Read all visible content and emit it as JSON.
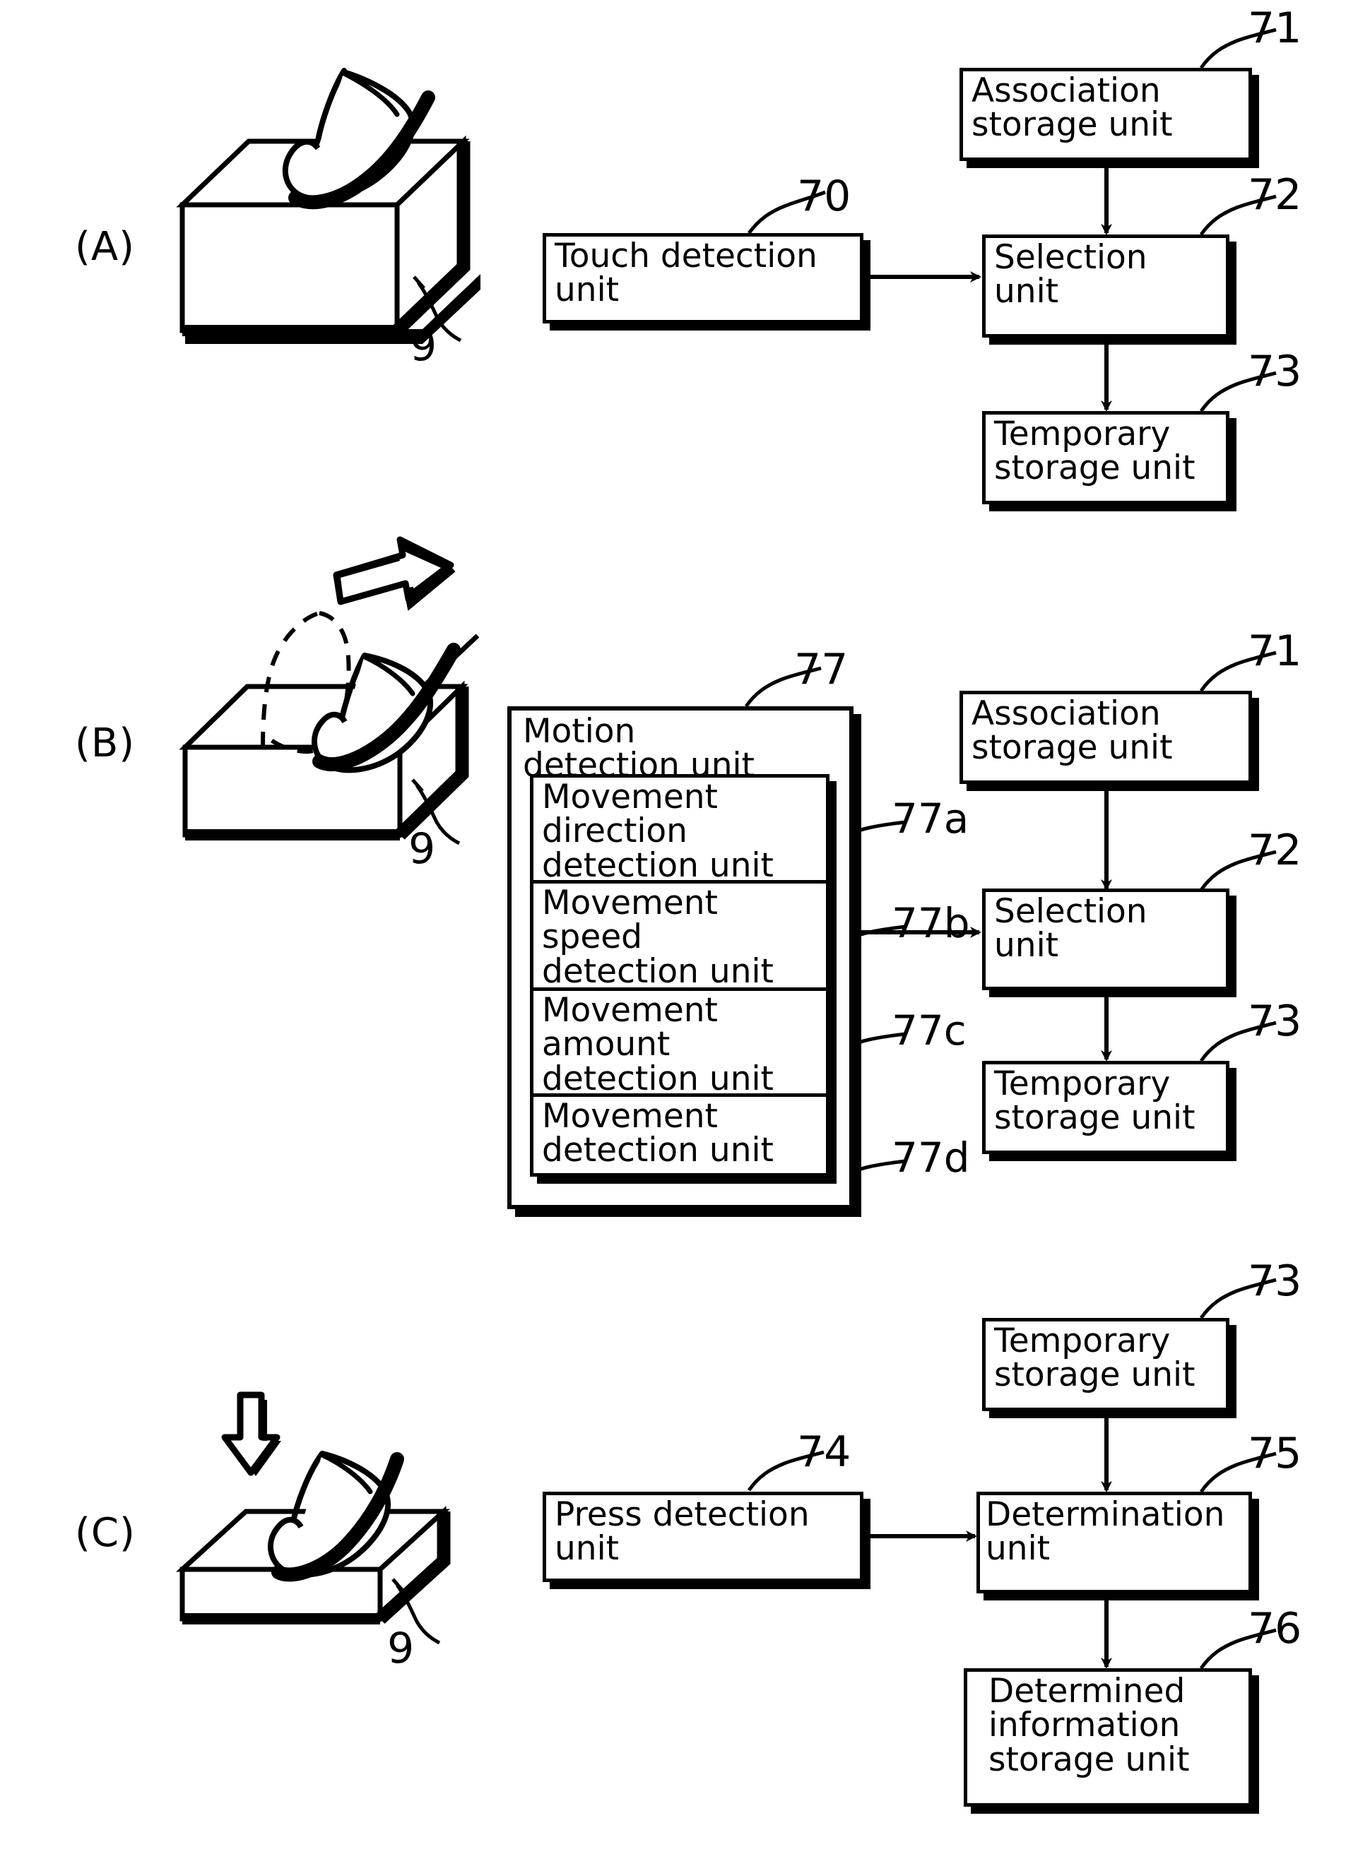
{
  "figure": {
    "type": "patent-block-diagram",
    "sections": [
      {
        "id": "A",
        "label": "(A)",
        "illustration": {
          "name": "finger-touching-pad",
          "device_ref": "9",
          "gesture": "touch"
        },
        "blocks": [
          {
            "ref": "70",
            "label": "Touch detection\nunit"
          },
          {
            "ref": "71",
            "label": "Association\nstorage unit"
          },
          {
            "ref": "72",
            "label": "Selection\nunit"
          },
          {
            "ref": "73",
            "label": "Temporary\nstorage unit"
          }
        ]
      },
      {
        "id": "B",
        "label": "(B)",
        "illustration": {
          "name": "finger-sliding-on-pad",
          "device_ref": "9",
          "gesture": "slide",
          "arrow": "right"
        },
        "blocks": [
          {
            "ref": "77",
            "label": "Motion\ndetection unit"
          },
          {
            "ref": "77a",
            "label": "Movement\ndirection\ndetection unit"
          },
          {
            "ref": "77b",
            "label": "Movement\nspeed\ndetection unit"
          },
          {
            "ref": "77c",
            "label": "Movement\namount\ndetection unit"
          },
          {
            "ref": "77d",
            "label": "Movement\ndetection unit"
          },
          {
            "ref": "71",
            "label": "Association\nstorage unit"
          },
          {
            "ref": "72",
            "label": "Selection\nunit"
          },
          {
            "ref": "73",
            "label": "Temporary\nstorage unit"
          }
        ]
      },
      {
        "id": "C",
        "label": "(C)",
        "illustration": {
          "name": "finger-pressing-pad",
          "device_ref": "9",
          "gesture": "press",
          "arrow": "down"
        },
        "blocks": [
          {
            "ref": "73",
            "label": "Temporary\nstorage unit"
          },
          {
            "ref": "74",
            "label": "Press detection\nunit"
          },
          {
            "ref": "75",
            "label": "Determination\nunit"
          },
          {
            "ref": "76",
            "label": "Determined\ninformation\nstorage unit"
          }
        ]
      }
    ],
    "refs": {
      "r70": "70",
      "r71a": "71",
      "r72a": "72",
      "r73a": "73",
      "r77": "77",
      "r77a": "77a",
      "r77b": "77b",
      "r77c": "77c",
      "r77d": "77d",
      "r71b": "71",
      "r72b": "72",
      "r73b": "73",
      "r73c": "73",
      "r74": "74",
      "r75": "75",
      "r76": "76",
      "r9a": "9",
      "r9b": "9",
      "r9c": "9"
    },
    "colors": {
      "ink": "#000000",
      "paper": "#ffffff"
    }
  }
}
